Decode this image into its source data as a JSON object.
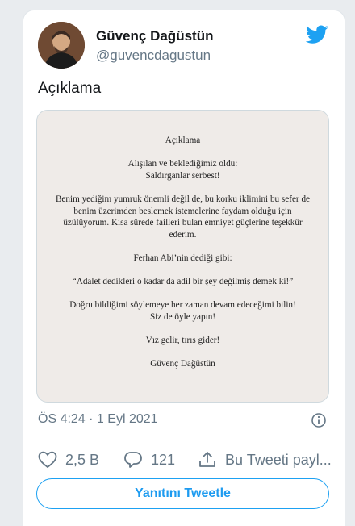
{
  "author": {
    "name": "Güvenç Dağüstün",
    "handle": "@guvencdagustun"
  },
  "tweet": {
    "text": "Açıklama",
    "timestamp": "ÖS 4:24 · 1 Eyl 2021"
  },
  "image_document": {
    "paragraphs": [
      "Açıklama",
      "Alışılan ve beklediğimiz oldu:\nSaldırganlar serbest!",
      "Benim yediğim yumruk önemli değil de, bu korku iklimini bu sefer de benim üzerimden beslemek istemelerine faydam olduğu için üzülüyorum. Kısa sürede failleri bulan emniyet güçlerine teşekkür ederim.",
      "Ferhan Abi’nin dediği gibi:",
      "“Adalet dedikleri o kadar da adil bir şey değilmiş demek ki!”",
      "Doğru bildiğimi söylemeye her zaman devam edeceğimi bilin!\nSiz de öyle yapın!",
      "Vız gelir, tırıs gider!",
      "Güvenç Dağüstün"
    ]
  },
  "actions": {
    "like_count": "2,5 B",
    "reply_count": "121",
    "share_label": "Bu Tweeti payl..."
  },
  "reply_button_label": "Yanıtını Tweetle",
  "icons": {
    "twitter": "twitter-bird-icon",
    "info": "info-icon",
    "like": "heart-icon",
    "reply": "comment-bubble-icon",
    "share": "share-icon"
  },
  "colors": {
    "accent": "#1da1f2",
    "text": "#14171a",
    "secondary": "#657786",
    "image_bg": "#efebe8"
  }
}
